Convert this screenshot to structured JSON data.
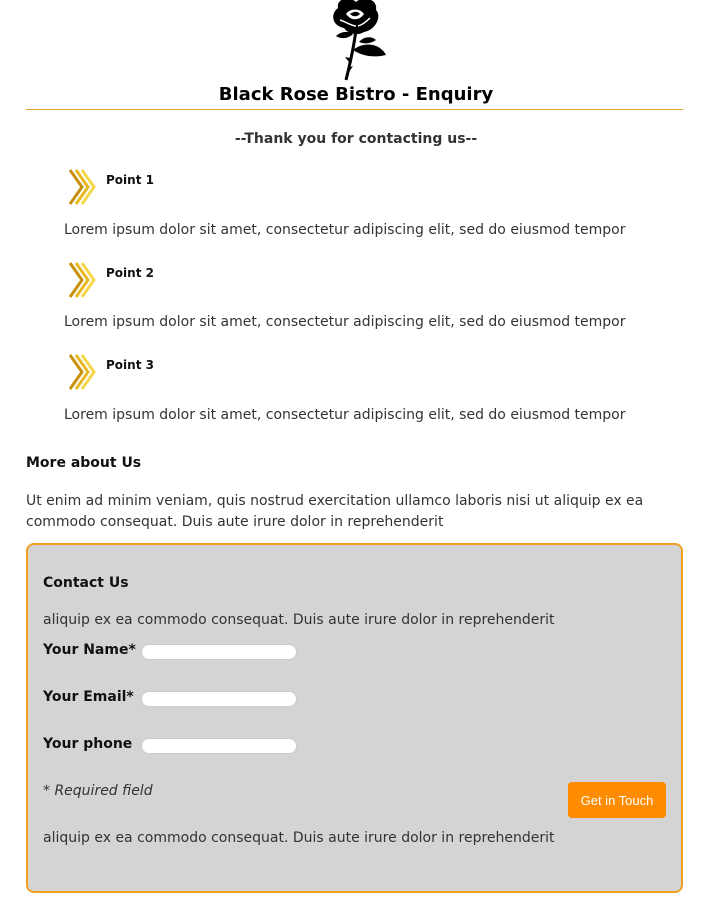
{
  "header": {
    "logo_icon": "black-rose-icon",
    "title": "Black Rose Bistro - Enquiry",
    "thanks": "--Thank you for contacting us--"
  },
  "points": [
    {
      "icon": "chevron-right-icon",
      "title": "Point 1",
      "text": "Lorem ipsum dolor sit amet, consectetur adipiscing elit, sed do eiusmod tempor"
    },
    {
      "icon": "chevron-right-icon",
      "title": "Point 2",
      "text": "Lorem ipsum dolor sit amet, consectetur adipiscing elit, sed do eiusmod tempor"
    },
    {
      "icon": "chevron-right-icon",
      "title": "Point 3",
      "text": "Lorem ipsum dolor sit amet, consectetur adipiscing elit, sed do eiusmod tempor"
    }
  ],
  "about": {
    "title": "More about Us",
    "text": "Ut enim ad minim veniam, quis nostrud exercitation ullamco laboris nisi ut aliquip ex ea commodo consequat. Duis aute irure dolor in reprehenderit"
  },
  "contact": {
    "title": "Contact Us",
    "intro": "aliquip ex ea commodo consequat. Duis aute irure dolor in reprehenderit",
    "name_label": "Your Name*",
    "name_value": "",
    "email_label": "Your Email*",
    "email_value": "",
    "phone_label": "Your phone",
    "phone_value": "",
    "required_note": "* Required field",
    "submit_label": "Get in Touch",
    "footer_text": "aliquip ex ea commodo consequat. Duis aute irure dolor in reprehenderit"
  },
  "colors": {
    "accent": "#ff8c00",
    "border": "#f0a020",
    "panel": "#d4d4d4",
    "rule": "#e0a030"
  }
}
